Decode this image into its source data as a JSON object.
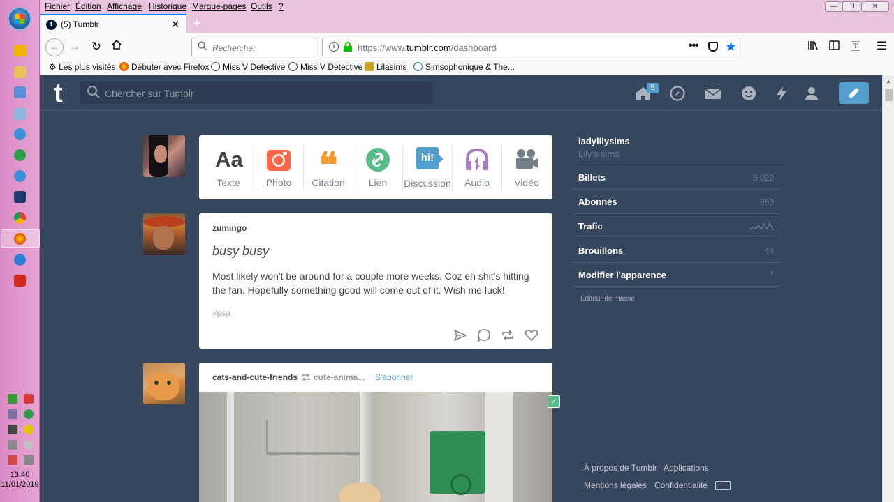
{
  "taskbar": {
    "time": "13:40",
    "date": "11/01/2019"
  },
  "menubar": {
    "items": [
      "Fichier",
      "Édition",
      "Affichage",
      "Historique",
      "Marque-pages",
      "Outils",
      "?"
    ]
  },
  "tab": {
    "title": "(5) Tumblr",
    "close": "✕",
    "new": "+"
  },
  "navbar": {
    "search_placeholder": "Rechercher",
    "url_prefix": "https://www.",
    "url_host": "tumblr.com",
    "url_path": "/dashboard"
  },
  "bookmarks": [
    "Les plus visités",
    "Débuter avec Firefox",
    "Miss V Detective",
    "Miss V Detective",
    "Lilasims",
    "Simsophonique & The..."
  ],
  "tumblr": {
    "logo": "t",
    "search_placeholder": "Chercher sur Tumblr",
    "home_badge": "5",
    "post_types": [
      {
        "label": "Texte",
        "glyph": "Aa"
      },
      {
        "label": "Photo"
      },
      {
        "label": "Citation",
        "glyph": "❝"
      },
      {
        "label": "Lien"
      },
      {
        "label": "Discussion",
        "glyph": "hi!"
      },
      {
        "label": "Audio"
      },
      {
        "label": "Vidéo"
      }
    ],
    "posts": [
      {
        "author": "zumingo",
        "title": "busy busy",
        "body": "Most likely won't be around for a couple more weeks. Coz eh shit's hitting the fan. Hopefully something good will come out of it. Wish me luck!",
        "tag": "#psa"
      },
      {
        "author": "cats-and-cute-friends",
        "reblogged_from": "cute-anima...",
        "follow": "S'abonner"
      }
    ],
    "sidebar": {
      "blog_name": "ladylilysims",
      "blog_title": "Lily's sims",
      "rows": [
        {
          "label": "Billets",
          "value": "5 022"
        },
        {
          "label": "Abonnés",
          "value": "363"
        },
        {
          "label": "Trafic"
        },
        {
          "label": "Brouillons",
          "value": "44"
        },
        {
          "label": "Modifier l'apparence",
          "value": "›"
        }
      ],
      "mass_editor": "Éditeur de masse"
    },
    "footer": {
      "about": "À propos de Tumblr",
      "apps": "Applications",
      "legal": "Mentions légales",
      "privacy": "Confidentialité"
    }
  },
  "colors": {
    "tumblr_bg": "#36465d",
    "accent": "#529ecc",
    "taskbar": "#e6a4d3"
  }
}
